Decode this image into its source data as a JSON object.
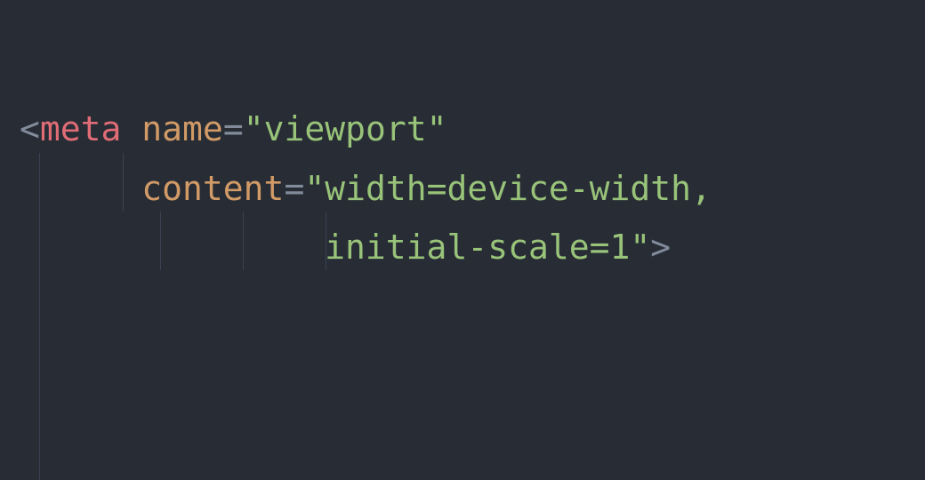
{
  "code": {
    "line1": {
      "open": "<",
      "tag": "meta",
      "space1": " ",
      "attr": "name",
      "eq": "=",
      "val": "\"viewport\""
    },
    "line2": {
      "indent": "      ",
      "attr": "content",
      "eq": "=",
      "val_part": "\"width=device-width,"
    },
    "line3": {
      "indent": "               ",
      "val_part": "initial-scale=1\"",
      "close": ">"
    }
  }
}
